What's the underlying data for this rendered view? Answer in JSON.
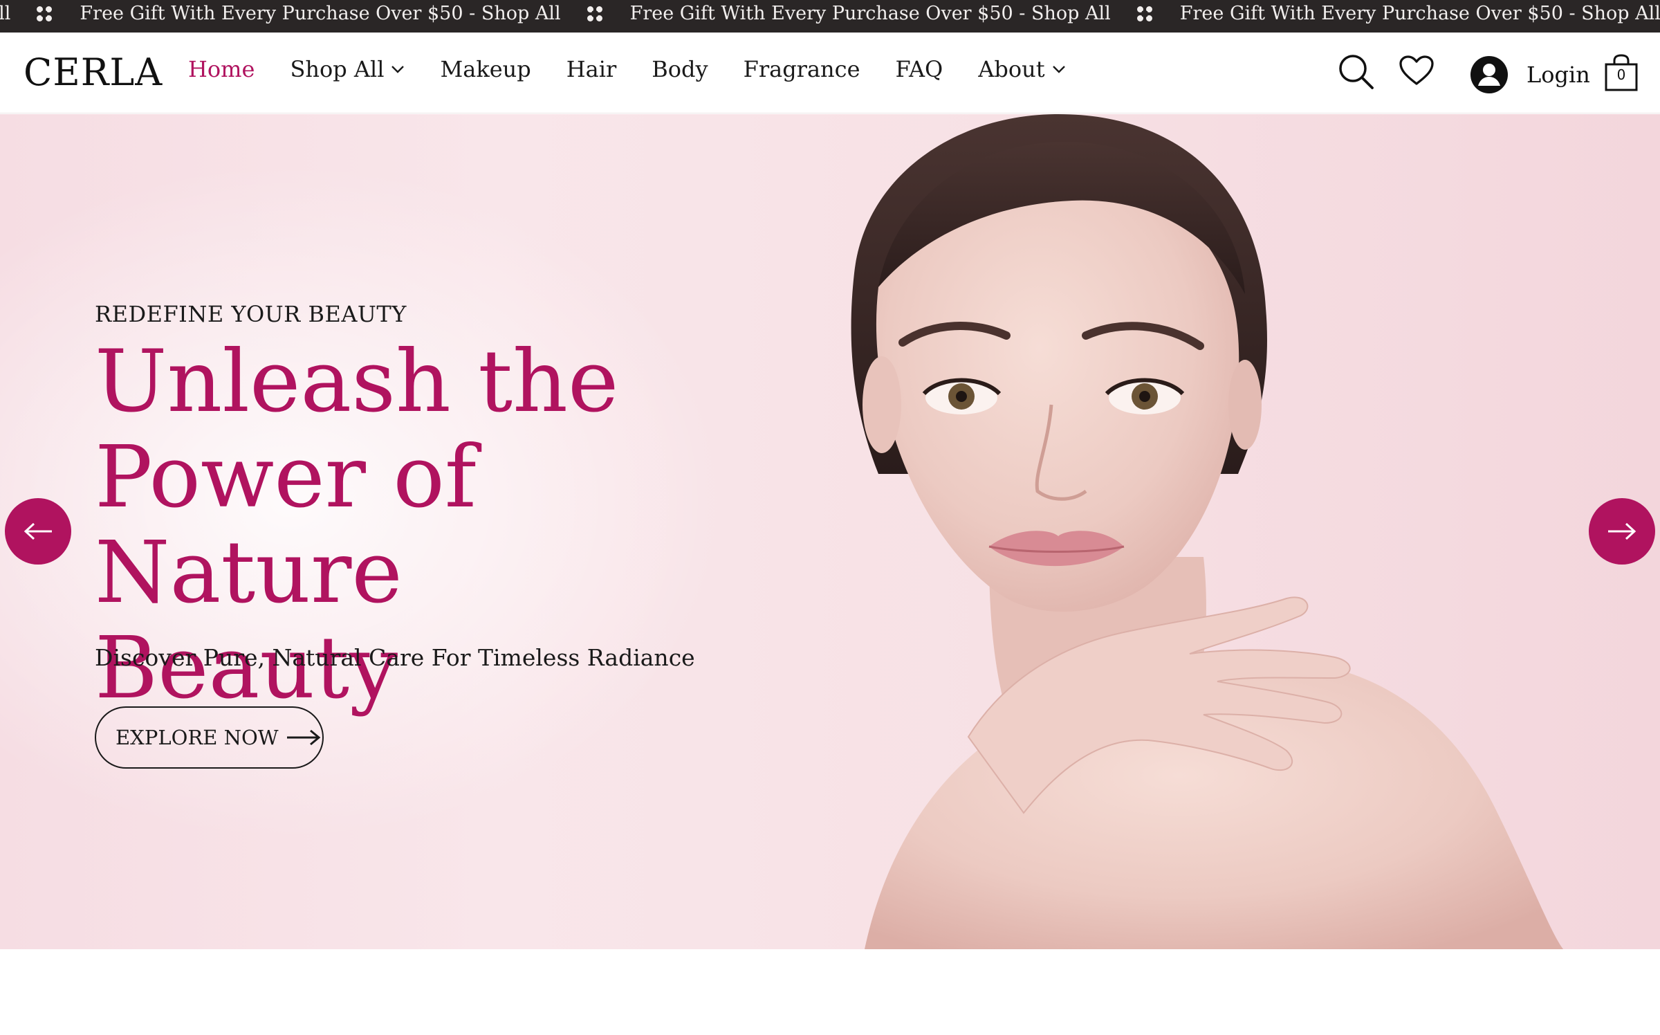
{
  "announcement": {
    "lead_fragment": "50 - Shop All",
    "message": "Free Gift With Every Purchase Over $50 - Shop All",
    "tail_fragment": "Fr"
  },
  "header": {
    "logo": "CERLA",
    "nav": [
      {
        "label": "Home",
        "active": true,
        "has_dropdown": false
      },
      {
        "label": "Shop All",
        "active": false,
        "has_dropdown": true
      },
      {
        "label": "Makeup",
        "active": false,
        "has_dropdown": false
      },
      {
        "label": "Hair",
        "active": false,
        "has_dropdown": false
      },
      {
        "label": "Body",
        "active": false,
        "has_dropdown": false
      },
      {
        "label": "Fragrance",
        "active": false,
        "has_dropdown": false
      },
      {
        "label": "FAQ",
        "active": false,
        "has_dropdown": false
      },
      {
        "label": "About",
        "active": false,
        "has_dropdown": true
      }
    ],
    "login_label": "Login",
    "cart_count": "0",
    "icons": [
      "search-icon",
      "heart-icon",
      "account-icon",
      "cart-bag-icon"
    ]
  },
  "hero": {
    "eyebrow": "REDEFINE YOUR BEAUTY",
    "title_line1": "Unleash the",
    "title_line2": "Power of Nature",
    "title_line3": "Beauty",
    "subtitle": "Discover Pure, Natural Care For Timeless Radiance",
    "cta_label": "EXPLORE NOW",
    "prev_icon": "arrow-left-icon",
    "next_icon": "arrow-right-icon"
  },
  "colors": {
    "accent": "#b0135f",
    "announcement_bg": "#2a2626",
    "hero_bg": "#f7e1e5",
    "text": "#1a1a1a"
  }
}
